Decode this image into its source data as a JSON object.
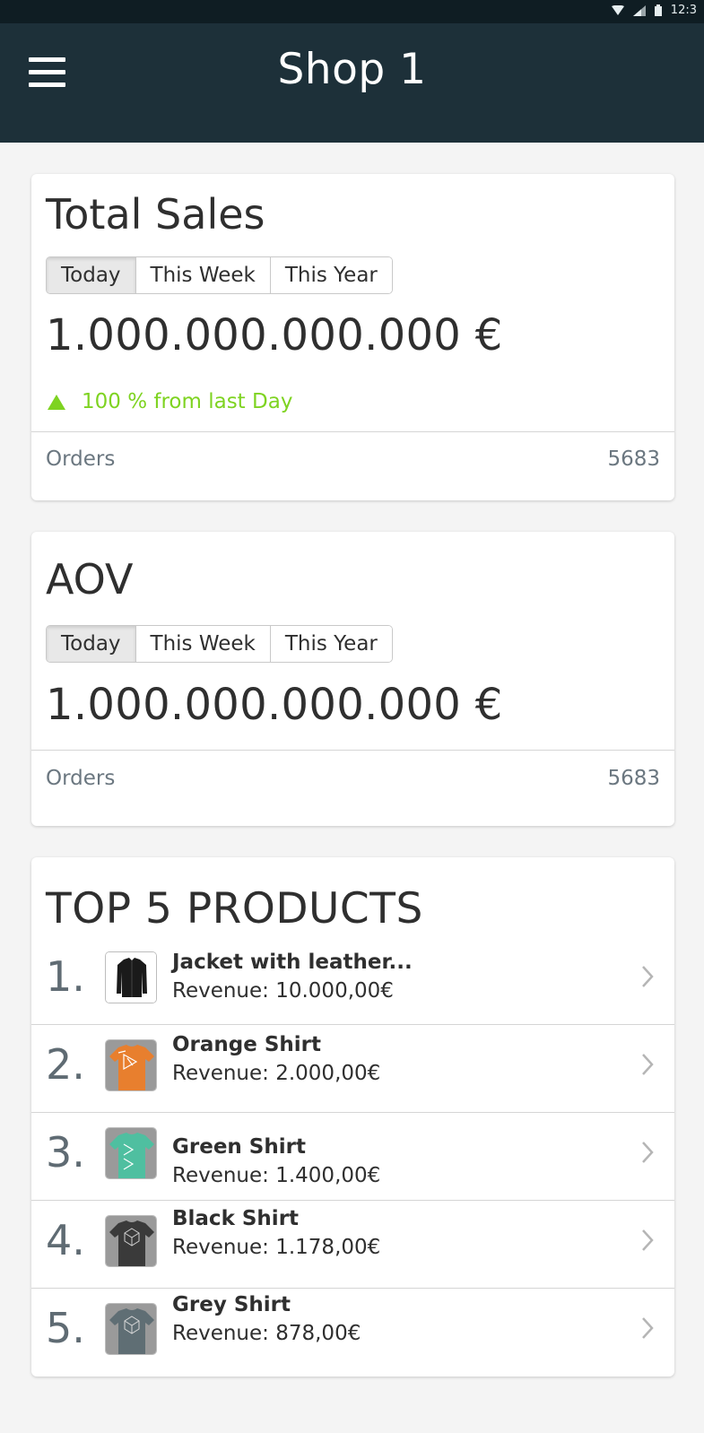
{
  "status_bar": {
    "time": "12:3"
  },
  "header": {
    "title": "Shop 1"
  },
  "total_sales": {
    "title": "Total Sales",
    "ranges": [
      "Today",
      "This Week",
      "This Year"
    ],
    "value": "1.000.000.000.000 €",
    "trend": "100 % from last Day",
    "orders_label": "Orders",
    "orders_value": "5683"
  },
  "aov": {
    "title": "AOV",
    "ranges": [
      "Today",
      "This Week",
      "This Year"
    ],
    "value": "1.000.000.000.000 €",
    "orders_label": "Orders",
    "orders_value": "5683"
  },
  "top_products": {
    "title": "TOP 5 PRODUCTS",
    "items": [
      {
        "rank": "1.",
        "name": "Jacket with leather...",
        "revenue": "Revenue: 10.000,00€",
        "thumb_color": "#ffffff",
        "icon": "jacket-icon"
      },
      {
        "rank": "2.",
        "name": "Orange Shirt",
        "revenue": "Revenue: 2.000,00€",
        "thumb_color": "#e87f2e",
        "icon": "shirt-icon"
      },
      {
        "rank": "3.",
        "name": "Green Shirt",
        "revenue": "Revenue: 1.400,00€",
        "thumb_color": "#4fbfa0",
        "icon": "shirt-icon"
      },
      {
        "rank": "4.",
        "name": "Black Shirt",
        "revenue": "Revenue: 1.178,00€",
        "thumb_color": "#3a3a3a",
        "icon": "shirt-icon"
      },
      {
        "rank": "5.",
        "name": "Grey Shirt",
        "revenue": "Revenue: 878,00€",
        "thumb_color": "#5f6e74",
        "icon": "shirt-icon"
      }
    ]
  },
  "colors": {
    "header_bg": "#1d3039",
    "status_bg": "#0f1d23",
    "trend_up": "#7ed321"
  }
}
